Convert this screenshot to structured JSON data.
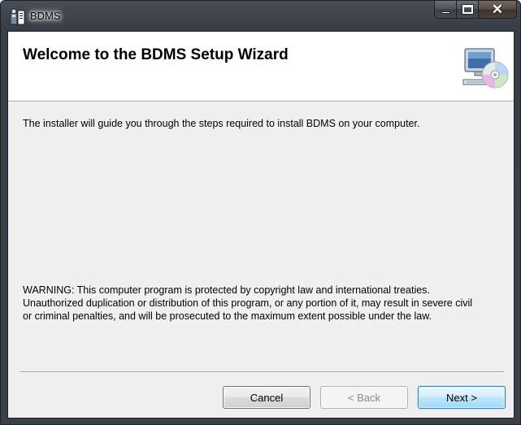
{
  "window": {
    "title": "BDMS",
    "controls": {
      "minimize_icon": "minimize-icon",
      "maximize_icon": "maximize-icon",
      "close_glyph": "✕"
    }
  },
  "header": {
    "title": "Welcome to the BDMS Setup Wizard",
    "logo_icon": "computer-cd-icon"
  },
  "body": {
    "intro": "The installer will guide you through the steps required to install BDMS on your computer.",
    "warning_lines": [
      "WARNING: This computer program is protected by copyright law and international treaties.",
      "Unauthorized duplication or distribution of this program, or any portion of it, may result in severe civil",
      "or criminal penalties, and will be prosecuted to the maximum extent possible under the law."
    ]
  },
  "buttons": {
    "cancel": "Cancel",
    "back": "< Back",
    "next": "Next >",
    "back_enabled": false,
    "default_button": "next"
  },
  "colors": {
    "titlebar": "#3b4048",
    "client_bg": "#f0f0f0",
    "header_bg": "#ffffff",
    "default_button_border": "#3c7fb1"
  }
}
